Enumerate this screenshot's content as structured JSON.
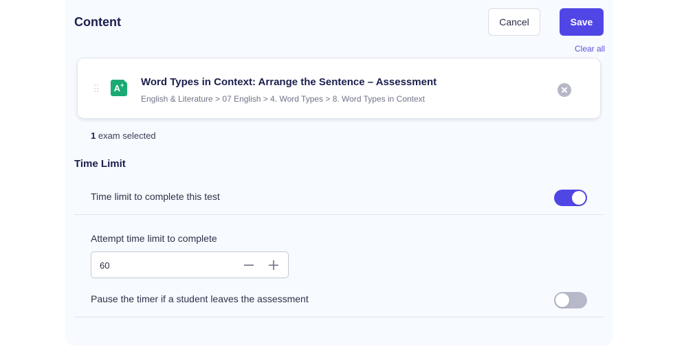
{
  "header": {
    "title": "Content",
    "cancel_label": "Cancel",
    "save_label": "Save",
    "clear_all_label": "Clear all"
  },
  "selected_item": {
    "icon": "assessment-a-plus-icon",
    "icon_text": "A",
    "icon_sup": "+",
    "title": "Word Types in Context: Arrange the Sentence – Assessment",
    "path": "English & Literature > 07 English > 4. Word Types > 8. Word Types in Context"
  },
  "selection_summary": {
    "count": "1",
    "suffix": " exam selected"
  },
  "time_limit": {
    "section_title": "Time Limit",
    "enable_label": "Time limit to complete this test",
    "enable_on": true,
    "attempt_label": "Attempt time limit to complete",
    "attempt_value": "60",
    "pause_label": "Pause the timer if a student leaves the assessment",
    "pause_on": false
  },
  "colors": {
    "accent": "#5046e5",
    "icon_green": "#1aaa72",
    "panel_bg": "#f7faff",
    "toggle_off": "#b7b9c8"
  }
}
